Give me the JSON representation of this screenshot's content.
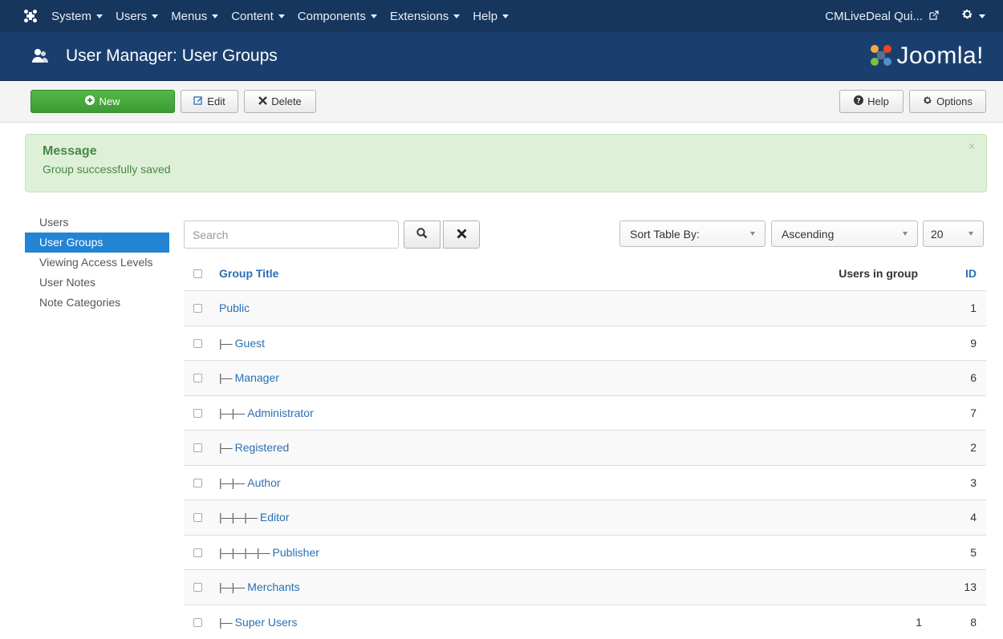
{
  "navbar": {
    "menu": [
      "System",
      "Users",
      "Menus",
      "Content",
      "Components",
      "Extensions",
      "Help"
    ],
    "site_link": "CMLiveDeal Qui...",
    "logo_icon": "joomla-logo-icon",
    "settings_icon": "gear-icon"
  },
  "header": {
    "title": "User Manager: User Groups",
    "brand": "Joomla!"
  },
  "toolbar": {
    "new_label": "New",
    "edit_label": "Edit",
    "delete_label": "Delete",
    "help_label": "Help",
    "options_label": "Options"
  },
  "message": {
    "heading": "Message",
    "text": "Group successfully saved",
    "close": "×"
  },
  "sidebar": {
    "items": [
      {
        "label": "Users",
        "active": false
      },
      {
        "label": "User Groups",
        "active": true
      },
      {
        "label": "Viewing Access Levels",
        "active": false
      },
      {
        "label": "User Notes",
        "active": false
      },
      {
        "label": "Note Categories",
        "active": false
      }
    ]
  },
  "filters": {
    "search_placeholder": "Search",
    "sort_label": "Sort Table By:",
    "direction_label": "Ascending",
    "limit_label": "20"
  },
  "table": {
    "headers": {
      "title": "Group Title",
      "users": "Users in group",
      "id": "ID"
    },
    "rows": [
      {
        "prefix": "",
        "title": "Public",
        "users": "",
        "id": "1"
      },
      {
        "prefix": "|—",
        "title": "Guest",
        "users": "",
        "id": "9"
      },
      {
        "prefix": "|—",
        "title": "Manager",
        "users": "",
        "id": "6"
      },
      {
        "prefix": "|—|—",
        "title": "Administrator",
        "users": "",
        "id": "7"
      },
      {
        "prefix": "|—",
        "title": "Registered",
        "users": "",
        "id": "2"
      },
      {
        "prefix": "|—|—",
        "title": "Author",
        "users": "",
        "id": "3"
      },
      {
        "prefix": "|—|—|—",
        "title": "Editor",
        "users": "",
        "id": "4"
      },
      {
        "prefix": "|—|—|—|—",
        "title": "Publisher",
        "users": "",
        "id": "5"
      },
      {
        "prefix": "|—|—",
        "title": "Merchants",
        "users": "",
        "id": "13"
      },
      {
        "prefix": "|—",
        "title": "Super Users",
        "users": "1",
        "id": "8"
      }
    ]
  },
  "colors": {
    "navbar": "#17365d",
    "header": "#1a3f6f",
    "accent": "#2384d3",
    "success": "#468847"
  }
}
